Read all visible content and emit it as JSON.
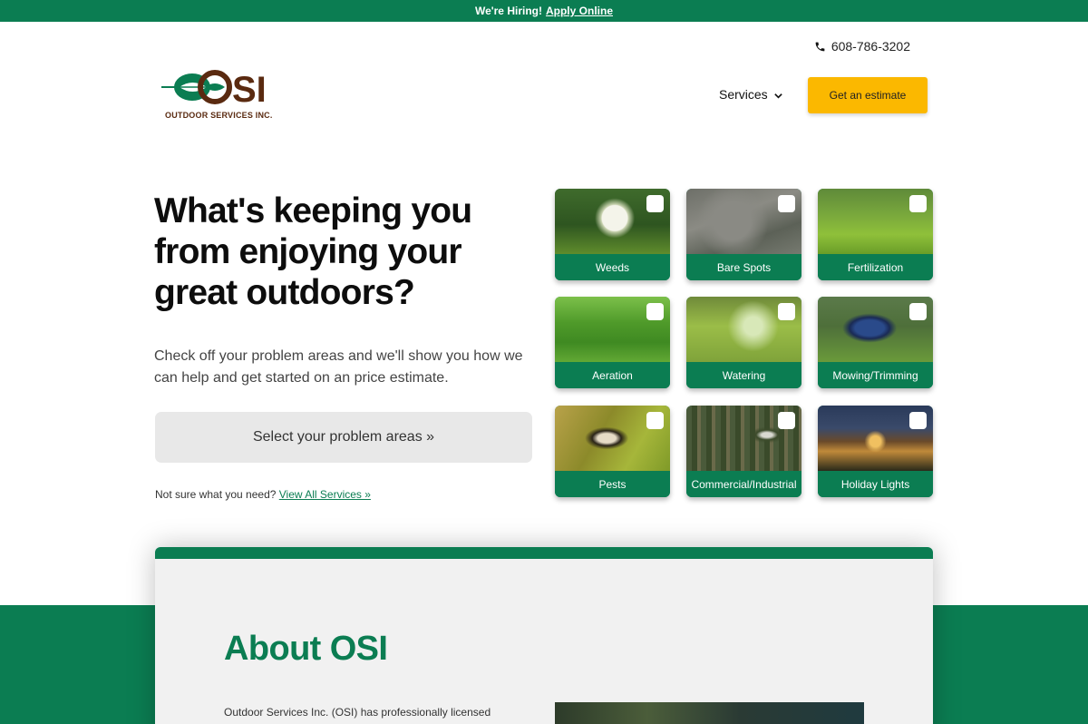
{
  "topbar": {
    "text": "We're Hiring!",
    "link": "Apply Online"
  },
  "header": {
    "phone": "608-786-3202",
    "logo_text": "OUTDOOR SERVICES INC.",
    "logo_mark": "OSI",
    "nav_services": "Services",
    "estimate_button": "Get an estimate"
  },
  "hero": {
    "title": "What's keeping you from enjoying your great outdoors?",
    "text": "Check off your problem areas and we'll show you how we can help and get started on an price estimate.",
    "select_button": "Select your problem areas »",
    "unsure_text": "Not sure what you need?",
    "unsure_link": "View All Services »"
  },
  "services": [
    {
      "label": "Weeds"
    },
    {
      "label": "Bare Spots"
    },
    {
      "label": "Fertilization"
    },
    {
      "label": "Aeration"
    },
    {
      "label": "Watering"
    },
    {
      "label": "Mowing/Trimming"
    },
    {
      "label": "Pests"
    },
    {
      "label": "Commercial/Industrial"
    },
    {
      "label": "Holiday Lights"
    }
  ],
  "about": {
    "title": "About OSI",
    "text": "Outdoor Services Inc. (OSI) has professionally licensed"
  },
  "colors": {
    "brand_green": "#0b7d52",
    "accent_yellow": "#fbb800",
    "logo_brown": "#5a2a10"
  }
}
